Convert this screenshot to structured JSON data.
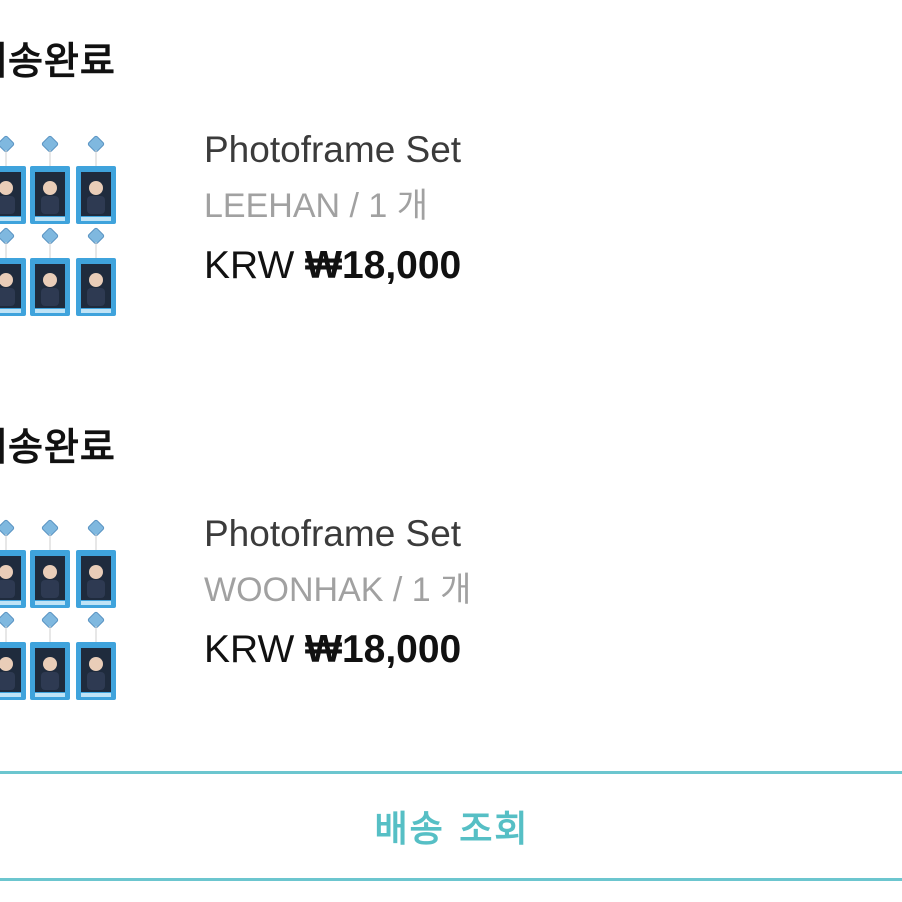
{
  "orders": [
    {
      "status": "배송완료",
      "product": {
        "name": "Photoframe Set",
        "option": "LEEHAN / 1 개",
        "currency": "KRW",
        "price": "₩18,000",
        "image_icon": "photoframe-set-thumbnail"
      }
    },
    {
      "status": "배송완료",
      "product": {
        "name": "Photoframe Set",
        "option": "WOONHAK / 1 개",
        "currency": "KRW",
        "price": "₩18,000",
        "image_icon": "photoframe-set-thumbnail"
      }
    }
  ],
  "tracking_button": {
    "label": "배송 조회"
  },
  "colors": {
    "accent": "#56bfc5",
    "frame_blue": "#3fa3dc"
  }
}
